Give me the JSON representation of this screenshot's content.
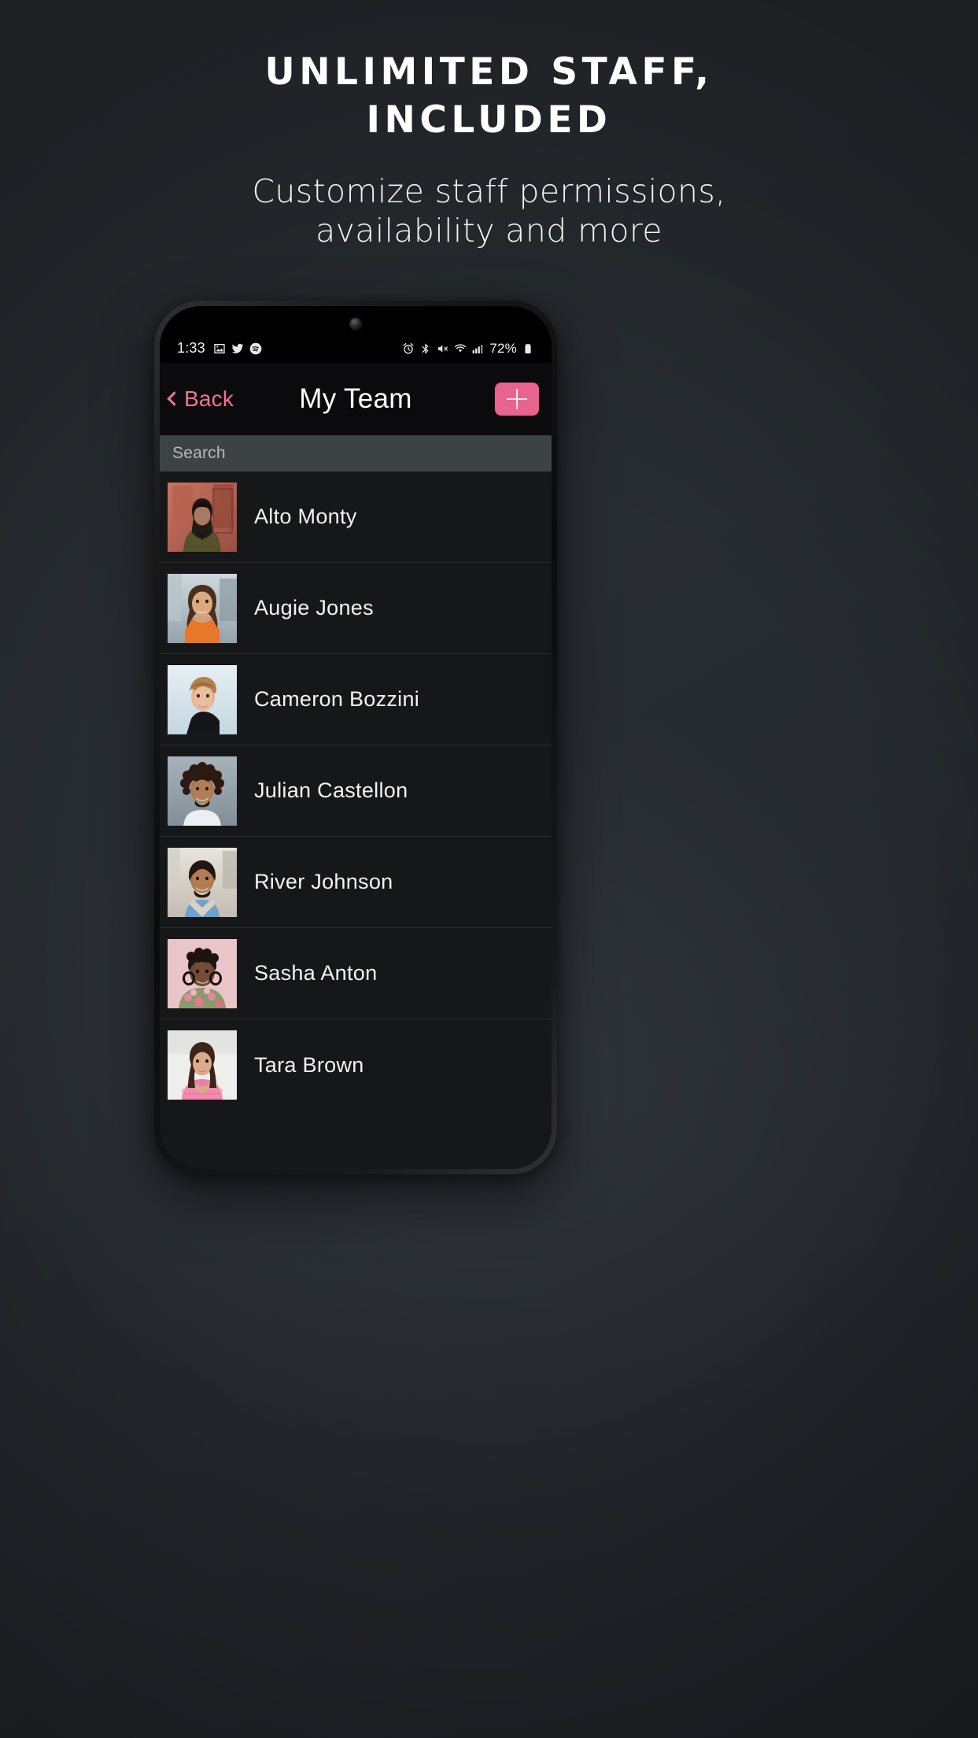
{
  "promo": {
    "headline_line1": "Unlimited Staff,",
    "headline_line2": "Included",
    "subtitle_line1": "Customize staff permissions,",
    "subtitle_line2": "availability and more"
  },
  "colors": {
    "page_background": "#282d31",
    "accent_pink": "#e8638d",
    "back_link_pink": "#ef7296",
    "screen_background": "#161719",
    "navbar_background": "#0b0b0d",
    "search_background": "#3d4245",
    "row_divider": "#2b2d30"
  },
  "status_bar": {
    "time": "1:33",
    "left_icons": [
      "photo-icon",
      "twitter-icon",
      "spotify-icon"
    ],
    "right_icons": [
      "alarm-icon",
      "bluetooth-icon",
      "mute-icon",
      "wifi-icon",
      "cellular-signal-icon"
    ],
    "battery_percent": "72%",
    "battery_icon": "battery-icon"
  },
  "navbar": {
    "back_label": "Back",
    "back_icon": "chevron-left-icon",
    "title": "My Team",
    "add_icon": "plus-icon"
  },
  "search": {
    "value": "",
    "placeholder": "Search"
  },
  "team": {
    "members": [
      {
        "name": "Alto Monty",
        "avatar": "avatar-alto-monty"
      },
      {
        "name": "Augie Jones",
        "avatar": "avatar-augie-jones"
      },
      {
        "name": "Cameron Bozzini",
        "avatar": "avatar-cameron-bozzini"
      },
      {
        "name": "Julian Castellon",
        "avatar": "avatar-julian-castellon"
      },
      {
        "name": "River Johnson",
        "avatar": "avatar-river-johnson"
      },
      {
        "name": "Sasha Anton",
        "avatar": "avatar-sasha-anton"
      },
      {
        "name": "Tara Brown",
        "avatar": "avatar-tara-brown"
      }
    ]
  }
}
